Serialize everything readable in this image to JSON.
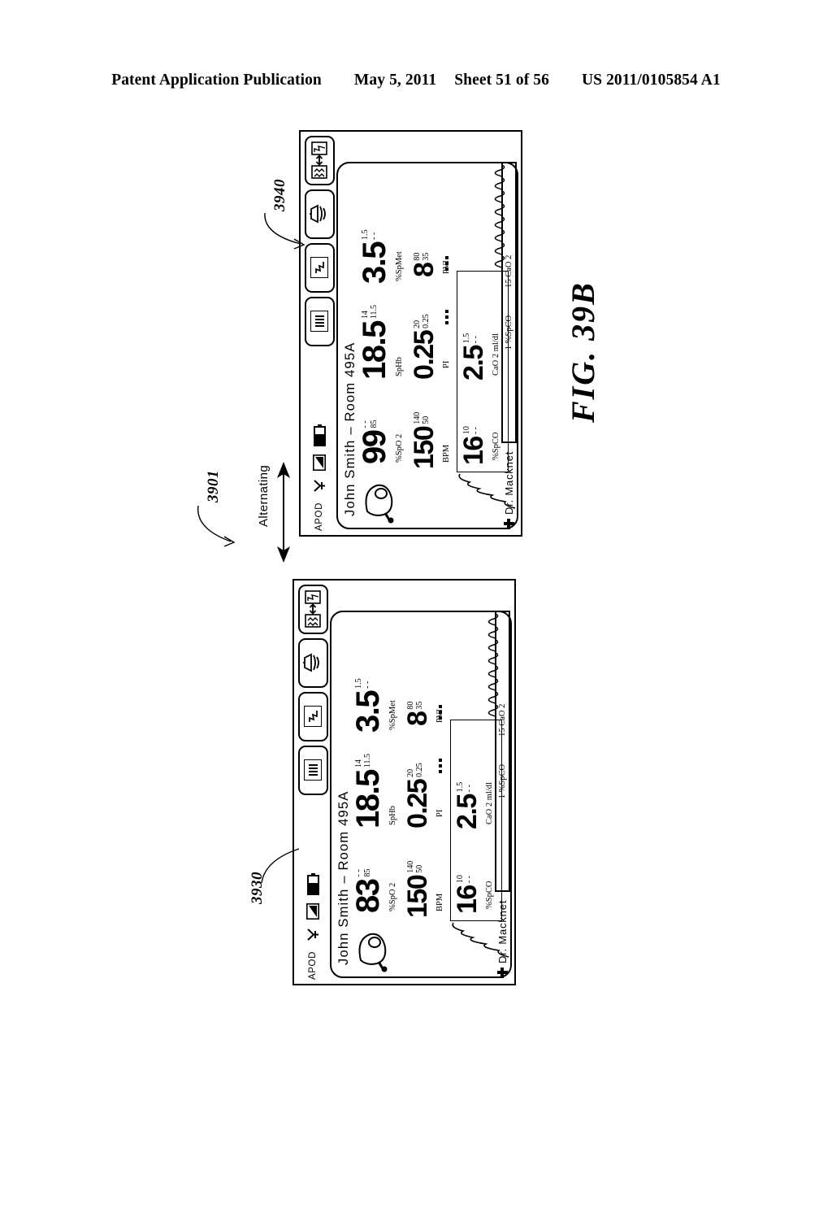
{
  "page_header": {
    "left": "Patent Application Publication",
    "date": "May 5, 2011",
    "sheet": "Sheet 51 of 56",
    "pub_number": "US 2011/0105854 A1"
  },
  "figure": {
    "caption": "FIG.  39B",
    "alternating_label": "Alternating",
    "ref_top": "3940",
    "ref_middle": "3901",
    "ref_bottom": "3930"
  },
  "device_common": {
    "status": {
      "apod": "APOD",
      "antenna_icon": "antenna-icon",
      "signal_icon": "signal-strength-icon",
      "battery_icon": "battery-icon"
    },
    "toolbar": [
      {
        "name": "bargraph-view-button",
        "icon": "vertical-bars-icon"
      },
      {
        "name": "waveform-view-button",
        "icon": "waveform-trace-icon"
      },
      {
        "name": "alarm-speaker-button",
        "icon": "speaker-alarm-icon"
      },
      {
        "name": "swap-display-button",
        "icon": "swap-traces-icon"
      }
    ],
    "patient": "John Smith  –  Room 495A",
    "clinician": "Dr. Macknet",
    "legend": {
      "spco": "1  %SpCO",
      "cao2": "15  CaO 2"
    },
    "params": [
      {
        "key": "spo2",
        "value": "99",
        "label": "%SpO 2",
        "limit_hi": "- -",
        "limit_lo": "85"
      },
      {
        "key": "sphb",
        "value": "18.5",
        "label": "SpHb",
        "limit_hi": "14",
        "limit_lo": "11.5"
      },
      {
        "key": "spmet",
        "value": "3.5",
        "label": "%SpMet",
        "limit_hi": "1.5",
        "limit_lo": "- -"
      },
      {
        "key": "bpm",
        "value": "150",
        "label": "BPM",
        "limit_hi": "140",
        "limit_lo": "50"
      },
      {
        "key": "pi",
        "value": "0.25",
        "label": "PI",
        "limit_hi": "20",
        "limit_lo": "0.25"
      },
      {
        "key": "pvi",
        "value": "8",
        "label": "PVI",
        "limit_hi": "80",
        "limit_lo": "35"
      },
      {
        "key": "spco",
        "value": "16",
        "label": "%SpCO",
        "limit_hi": "10",
        "limit_lo": "- -"
      },
      {
        "key": "cao2",
        "value": "2.5",
        "label": "CaO 2 ml/dl",
        "limit_hi": "1.5",
        "limit_lo": "- -"
      }
    ]
  },
  "device_top": {
    "ref": "3940",
    "spo2_value": "99",
    "sphb_value": "18.5",
    "spmet_value": "3.5",
    "bpm_value": "150",
    "pi_value": "0.25",
    "pvi_value": "8",
    "spco_value": "16",
    "cao2_value": "2.5",
    "spo2_limit_hi": "- -",
    "spo2_limit_lo": "85",
    "sphb_limit_hi": "14",
    "sphb_limit_lo": "11.5",
    "spmet_limit_hi": "1.5",
    "spmet_limit_lo": "- -",
    "bpm_limit_hi": "140",
    "bpm_limit_lo": "50",
    "pi_limit_hi": "20",
    "pi_limit_lo": "0.25",
    "pvi_limit_hi": "80",
    "pvi_limit_lo": "35",
    "spco_limit_hi": "10",
    "spco_limit_lo": "- -",
    "cao2_limit_hi": "1.5",
    "cao2_limit_lo": "- -",
    "patient": "John Smith  –  Room 495A",
    "clinician": "Dr. Macknet",
    "apod": "APOD",
    "legend_spco": "1  %SpCO",
    "legend_cao2": "15  CaO 2",
    "label_spo2": "%SpO 2",
    "label_sphb": "SpHb",
    "label_spmet": "%SpMet",
    "label_bpm": "BPM",
    "label_pi": "PI",
    "label_pvi": "PVI",
    "label_spco": "%SpCO",
    "label_cao2": "CaO 2 ml/dl"
  },
  "device_bottom": {
    "ref": "3930",
    "spo2_value": "83",
    "sphb_value": "18.5",
    "spmet_value": "3.5",
    "bpm_value": "150",
    "pi_value": "0.25",
    "pvi_value": "8",
    "spco_value": "16",
    "cao2_value": "2.5",
    "spo2_limit_hi": "- -",
    "spo2_limit_lo": "85",
    "sphb_limit_hi": "14",
    "sphb_limit_lo": "11.5",
    "spmet_limit_hi": "1.5",
    "spmet_limit_lo": "- -",
    "bpm_limit_hi": "140",
    "bpm_limit_lo": "50",
    "pi_limit_hi": "20",
    "pi_limit_lo": "0.25",
    "pvi_limit_hi": "80",
    "pvi_limit_lo": "35",
    "spco_limit_hi": "10",
    "spco_limit_lo": "- -",
    "cao2_limit_hi": "1.5",
    "cao2_limit_lo": "- -",
    "patient": "John Smith  –  Room 495A",
    "clinician": "Dr. Macknet",
    "apod": "APOD",
    "legend_spco": "1  %SpCO",
    "legend_cao2": "15  CaO 2",
    "label_spo2": "%SpO 2",
    "label_sphb": "SpHb",
    "label_spmet": "%SpMet",
    "label_bpm": "BPM",
    "label_pi": "PI",
    "label_pvi": "PVI",
    "label_spco": "%SpCO",
    "label_cao2": "CaO 2 ml/dl"
  }
}
